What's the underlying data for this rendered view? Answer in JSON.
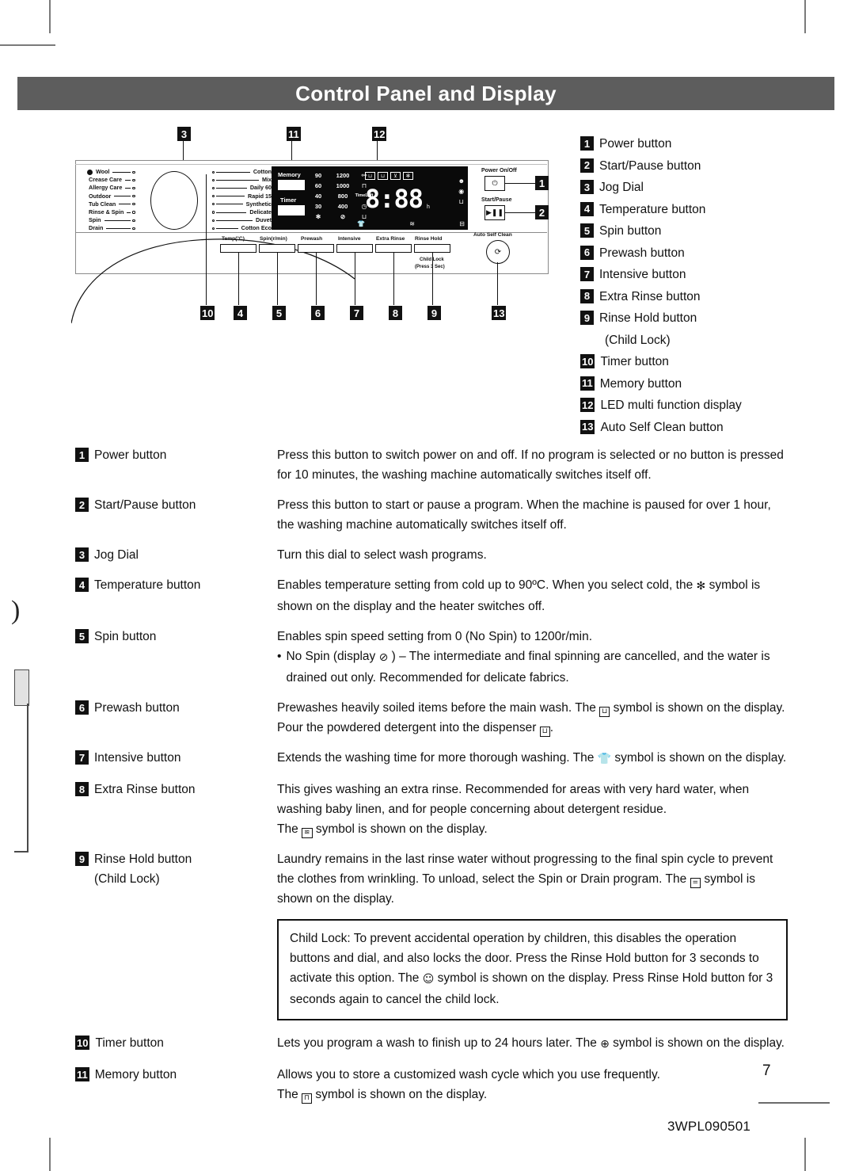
{
  "header": {
    "title": "Control Panel and Display"
  },
  "legend": {
    "items": [
      {
        "num": "1",
        "label": "Power button"
      },
      {
        "num": "2",
        "label": "Start/Pause button"
      },
      {
        "num": "3",
        "label": "Jog Dial"
      },
      {
        "num": "4",
        "label": "Temperature button"
      },
      {
        "num": "5",
        "label": "Spin button"
      },
      {
        "num": "6",
        "label": "Prewash button"
      },
      {
        "num": "7",
        "label": "Intensive button"
      },
      {
        "num": "8",
        "label": "Extra Rinse button"
      },
      {
        "num": "9",
        "label": "Rinse Hold button",
        "sub": "(Child Lock)"
      },
      {
        "num": "10",
        "label": "Timer button"
      },
      {
        "num": "11",
        "label": "Memory button"
      },
      {
        "num": "12",
        "label": "LED multi function display"
      },
      {
        "num": "13",
        "label": "Auto Self Clean button"
      }
    ]
  },
  "diagram": {
    "callouts": {
      "c1": "1",
      "c2": "2",
      "c3": "3",
      "c4": "4",
      "c5": "5",
      "c6": "6",
      "c7": "7",
      "c8": "8",
      "c9": "9",
      "c10": "10",
      "c11": "11",
      "c12": "12",
      "c13": "13"
    },
    "programs_left": [
      "Wool",
      "Crease Care",
      "Allergy Care",
      "Outdoor",
      "Tub Clean",
      "Rinse & Spin",
      "Spin",
      "Drain"
    ],
    "programs_right": [
      "Cotton",
      "Mix",
      "Daily 60",
      "Rapid 15",
      "Synthetic",
      "Delicate",
      "Duvet",
      "Cotton Eco"
    ],
    "led": {
      "memory_label": "Memory",
      "timer_label": "Timer",
      "temp_values": [
        "90",
        "60",
        "40",
        "30"
      ],
      "spin_values": [
        "1200",
        "1000",
        "800",
        "400"
      ],
      "time_left_label": "TimeLeft",
      "segment_value": "8:88",
      "hour_unit": "h",
      "cold_symbol": "✻",
      "nospin_symbol": "⊘",
      "prewash_symbol": "⊔"
    },
    "power_label": "Power On/Off",
    "startpause_label": "Start/Pause",
    "function_labels": [
      "Temp(°C)",
      "Spin(r/min)",
      "Prewash",
      "Intensive",
      "Extra Rinse",
      "Rinse Hold"
    ],
    "child_lock_label": "Child Lock",
    "child_lock_sub": "(Press 3 Sec)",
    "auto_self_clean_label": "Auto Self Clean"
  },
  "descriptions": [
    {
      "num": "1",
      "term": "Power button",
      "body": "Press this button to switch power on and off. If no program is selected or no button is pressed for 10 minutes, the washing machine automatically switches itself off."
    },
    {
      "num": "2",
      "term": "Start/Pause button",
      "body": "Press this button to start or pause a program. When the machine is paused for over 1 hour, the washing machine automatically switches itself off."
    },
    {
      "num": "3",
      "term": "Jog Dial",
      "body": "Turn this dial to select wash programs."
    },
    {
      "num": "4",
      "term": "Temperature button",
      "body_a": "Enables temperature setting from cold up to 90ºC. When you select cold, the",
      "symbol": "✻",
      "body_b": "symbol is shown on the display and the heater switches off."
    },
    {
      "num": "5",
      "term": "Spin button",
      "body": "Enables spin speed setting from 0 (No Spin) to 1200r/min.",
      "bullet_a": "No Spin (display",
      "bullet_symbol": "⊘",
      "bullet_b": ") – The intermediate and final spinning are cancelled, and the water is drained out only. Recommended for delicate fabrics."
    },
    {
      "num": "6",
      "term": "Prewash button",
      "body_a": "Prewashes heavily soiled items before the main wash. The",
      "symbol": "⊔",
      "body_b": "symbol is shown on the display. Pour the powdered detergent into the dispenser",
      "symbol2": "⊔",
      "body_c": "."
    },
    {
      "num": "7",
      "term": "Intensive button",
      "body_a": "Extends the washing time for more thorough washing. The",
      "symbol": "👕",
      "body_b": "symbol is shown on the display."
    },
    {
      "num": "8",
      "term": "Extra Rinse button",
      "body": "This gives washing an extra rinse. Recommended for areas with very hard water, when washing baby linen, and for people concerning about detergent residue.",
      "body_a": "The",
      "symbol": "≋",
      "body_b": "symbol is shown on the display."
    },
    {
      "num": "9",
      "term": "Rinse Hold button",
      "term_sub": "(Child Lock)",
      "body_a": "Laundry remains in the last rinse water without progressing to the final spin cycle to prevent the clothes from wrinkling. To unload, select the Spin or Drain program. The",
      "symbol": "=",
      "body_b": "symbol is shown on the display."
    },
    {
      "num": "10",
      "term": "Timer button",
      "body_a": "Lets you program a wash to finish up to 24 hours later. The",
      "symbol": "⊕",
      "body_b": "symbol is shown on the display."
    },
    {
      "num": "11",
      "term": "Memory button",
      "body": "Allows you to store a customized wash cycle which you use frequently.",
      "body_a": "The",
      "symbol": "⊓",
      "body_b": "symbol is shown on the display."
    }
  ],
  "child_lock_note": {
    "text_a": "Child Lock: To prevent accidental operation by children, this disables the operation buttons and dial, and also locks the door. Press the Rinse Hold button for 3 seconds to activate this option. The",
    "symbol": "☺",
    "text_b": "symbol is shown on the display. Press Rinse Hold button for 3 seconds again to cancel the child lock."
  },
  "footer": {
    "page_number": "7",
    "document_code": "3WPL090501"
  }
}
